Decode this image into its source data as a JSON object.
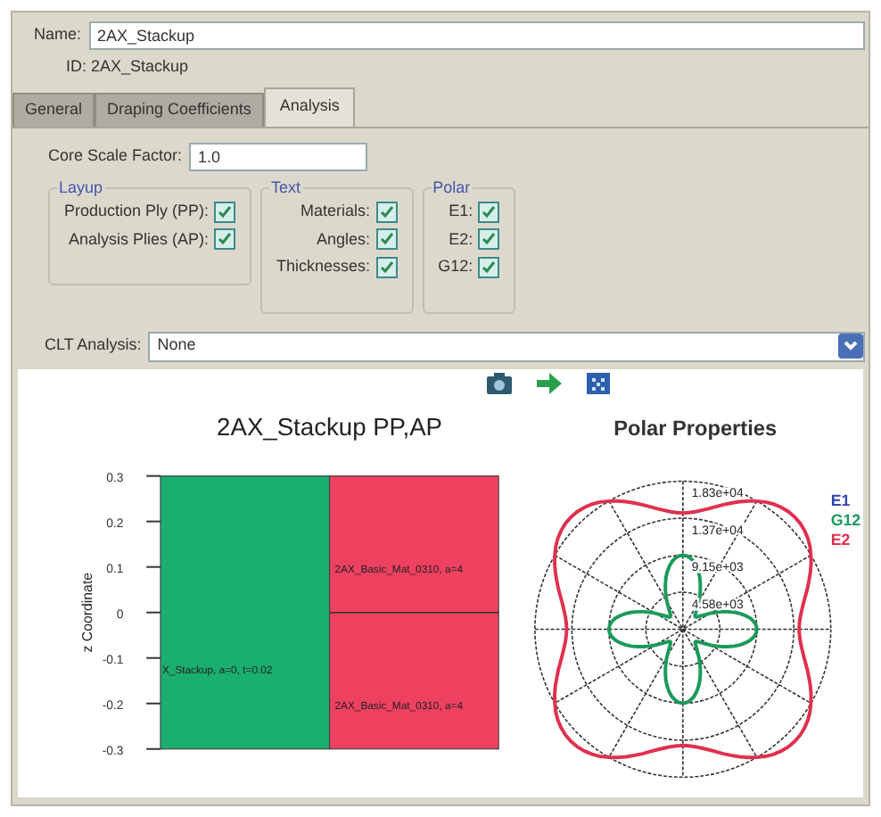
{
  "name_field": {
    "label": "Name:",
    "value": "2AX_Stackup"
  },
  "id_label": "ID: 2AX_Stackup",
  "tabs": [
    {
      "label": "General",
      "selected": false
    },
    {
      "label": "Draping Coefficients",
      "selected": false
    },
    {
      "label": "Analysis",
      "selected": true
    }
  ],
  "core_scale": {
    "label": "Core Scale Factor:",
    "value": "1.0"
  },
  "groups": [
    {
      "title": "Layup",
      "options": [
        {
          "label": "Production Ply (PP):",
          "checked": true
        },
        {
          "label": "Analysis Plies (AP):",
          "checked": true
        }
      ]
    },
    {
      "title": "Text",
      "options": [
        {
          "label": "Materials:",
          "checked": true
        },
        {
          "label": "Angles:",
          "checked": true
        },
        {
          "label": "Thicknesses:",
          "checked": true
        }
      ]
    },
    {
      "title": "Polar",
      "options": [
        {
          "label": "E1:",
          "checked": true
        },
        {
          "label": "E2:",
          "checked": true
        },
        {
          "label": "G12:",
          "checked": true
        }
      ]
    }
  ],
  "clt_analysis": {
    "label": "CLT Analysis:",
    "value": "None"
  },
  "layer_plot": {
    "title": "2AX_Stackup PP,AP",
    "ylabel": "z Coordinate",
    "yticks": [
      "0.3",
      "0.2",
      "0.1",
      "0",
      "-0.1",
      "-0.2",
      "-0.3"
    ],
    "layers": [
      {
        "color": "#1aae6f"
      },
      {
        "color": "#ee4160"
      }
    ],
    "labels": [
      "2AX_Basic_Mat_0310, a=4",
      "X_Stackup, a=0, t=0.02",
      "2AX_Basic_Mat_0310, a=4"
    ]
  },
  "polar_plot": {
    "title": "Polar Properties",
    "ring_labels": [
      "1.83e+04",
      "1.37e+04",
      "9.15e+03",
      "4.58e+03"
    ],
    "legend": [
      {
        "name": "E1",
        "color": "#3345b0"
      },
      {
        "name": "G12",
        "color": "#1a9a5a"
      },
      {
        "name": "E2",
        "color": "#e0304f"
      }
    ]
  }
}
